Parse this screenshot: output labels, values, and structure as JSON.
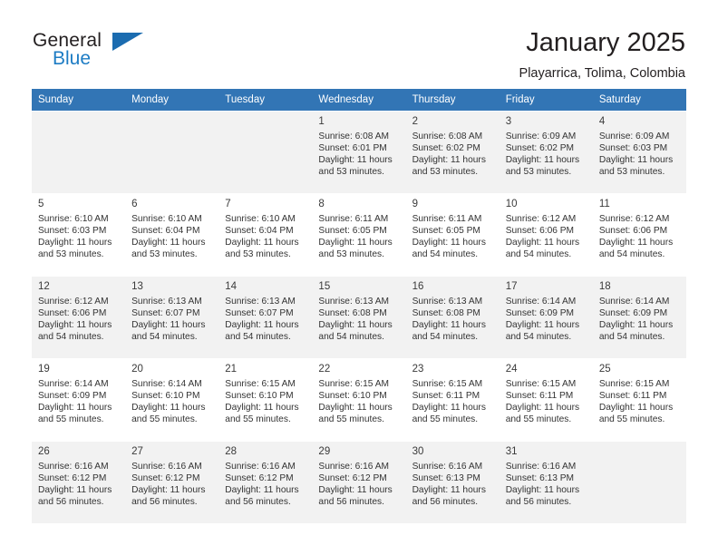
{
  "brand": {
    "name_part1": "General",
    "name_part2": "Blue",
    "flag_icon": "blue-triangle-flag-icon"
  },
  "header": {
    "title": "January 2025",
    "subtitle": "Playarrica, Tolima, Colombia"
  },
  "colors": {
    "header_row_bg": "#3275b5",
    "brand_blue": "#1d7cc4",
    "shaded_row_bg": "#f2f2f2",
    "text": "#333333"
  },
  "calendar": {
    "weekday_headers": [
      "Sunday",
      "Monday",
      "Tuesday",
      "Wednesday",
      "Thursday",
      "Friday",
      "Saturday"
    ],
    "labels": {
      "sunrise": "Sunrise:",
      "sunset": "Sunset:",
      "daylight": "Daylight:"
    },
    "weeks": [
      [
        {
          "day": "",
          "info": ""
        },
        {
          "day": "",
          "info": ""
        },
        {
          "day": "",
          "info": ""
        },
        {
          "day": "1",
          "info": "Sunrise: 6:08 AM\nSunset: 6:01 PM\nDaylight: 11 hours\nand 53 minutes."
        },
        {
          "day": "2",
          "info": "Sunrise: 6:08 AM\nSunset: 6:02 PM\nDaylight: 11 hours\nand 53 minutes."
        },
        {
          "day": "3",
          "info": "Sunrise: 6:09 AM\nSunset: 6:02 PM\nDaylight: 11 hours\nand 53 minutes."
        },
        {
          "day": "4",
          "info": "Sunrise: 6:09 AM\nSunset: 6:03 PM\nDaylight: 11 hours\nand 53 minutes."
        }
      ],
      [
        {
          "day": "5",
          "info": "Sunrise: 6:10 AM\nSunset: 6:03 PM\nDaylight: 11 hours\nand 53 minutes."
        },
        {
          "day": "6",
          "info": "Sunrise: 6:10 AM\nSunset: 6:04 PM\nDaylight: 11 hours\nand 53 minutes."
        },
        {
          "day": "7",
          "info": "Sunrise: 6:10 AM\nSunset: 6:04 PM\nDaylight: 11 hours\nand 53 minutes."
        },
        {
          "day": "8",
          "info": "Sunrise: 6:11 AM\nSunset: 6:05 PM\nDaylight: 11 hours\nand 53 minutes."
        },
        {
          "day": "9",
          "info": "Sunrise: 6:11 AM\nSunset: 6:05 PM\nDaylight: 11 hours\nand 54 minutes."
        },
        {
          "day": "10",
          "info": "Sunrise: 6:12 AM\nSunset: 6:06 PM\nDaylight: 11 hours\nand 54 minutes."
        },
        {
          "day": "11",
          "info": "Sunrise: 6:12 AM\nSunset: 6:06 PM\nDaylight: 11 hours\nand 54 minutes."
        }
      ],
      [
        {
          "day": "12",
          "info": "Sunrise: 6:12 AM\nSunset: 6:06 PM\nDaylight: 11 hours\nand 54 minutes."
        },
        {
          "day": "13",
          "info": "Sunrise: 6:13 AM\nSunset: 6:07 PM\nDaylight: 11 hours\nand 54 minutes."
        },
        {
          "day": "14",
          "info": "Sunrise: 6:13 AM\nSunset: 6:07 PM\nDaylight: 11 hours\nand 54 minutes."
        },
        {
          "day": "15",
          "info": "Sunrise: 6:13 AM\nSunset: 6:08 PM\nDaylight: 11 hours\nand 54 minutes."
        },
        {
          "day": "16",
          "info": "Sunrise: 6:13 AM\nSunset: 6:08 PM\nDaylight: 11 hours\nand 54 minutes."
        },
        {
          "day": "17",
          "info": "Sunrise: 6:14 AM\nSunset: 6:09 PM\nDaylight: 11 hours\nand 54 minutes."
        },
        {
          "day": "18",
          "info": "Sunrise: 6:14 AM\nSunset: 6:09 PM\nDaylight: 11 hours\nand 54 minutes."
        }
      ],
      [
        {
          "day": "19",
          "info": "Sunrise: 6:14 AM\nSunset: 6:09 PM\nDaylight: 11 hours\nand 55 minutes."
        },
        {
          "day": "20",
          "info": "Sunrise: 6:14 AM\nSunset: 6:10 PM\nDaylight: 11 hours\nand 55 minutes."
        },
        {
          "day": "21",
          "info": "Sunrise: 6:15 AM\nSunset: 6:10 PM\nDaylight: 11 hours\nand 55 minutes."
        },
        {
          "day": "22",
          "info": "Sunrise: 6:15 AM\nSunset: 6:10 PM\nDaylight: 11 hours\nand 55 minutes."
        },
        {
          "day": "23",
          "info": "Sunrise: 6:15 AM\nSunset: 6:11 PM\nDaylight: 11 hours\nand 55 minutes."
        },
        {
          "day": "24",
          "info": "Sunrise: 6:15 AM\nSunset: 6:11 PM\nDaylight: 11 hours\nand 55 minutes."
        },
        {
          "day": "25",
          "info": "Sunrise: 6:15 AM\nSunset: 6:11 PM\nDaylight: 11 hours\nand 55 minutes."
        }
      ],
      [
        {
          "day": "26",
          "info": "Sunrise: 6:16 AM\nSunset: 6:12 PM\nDaylight: 11 hours\nand 56 minutes."
        },
        {
          "day": "27",
          "info": "Sunrise: 6:16 AM\nSunset: 6:12 PM\nDaylight: 11 hours\nand 56 minutes."
        },
        {
          "day": "28",
          "info": "Sunrise: 6:16 AM\nSunset: 6:12 PM\nDaylight: 11 hours\nand 56 minutes."
        },
        {
          "day": "29",
          "info": "Sunrise: 6:16 AM\nSunset: 6:12 PM\nDaylight: 11 hours\nand 56 minutes."
        },
        {
          "day": "30",
          "info": "Sunrise: 6:16 AM\nSunset: 6:13 PM\nDaylight: 11 hours\nand 56 minutes."
        },
        {
          "day": "31",
          "info": "Sunrise: 6:16 AM\nSunset: 6:13 PM\nDaylight: 11 hours\nand 56 minutes."
        },
        {
          "day": "",
          "info": ""
        }
      ]
    ]
  }
}
